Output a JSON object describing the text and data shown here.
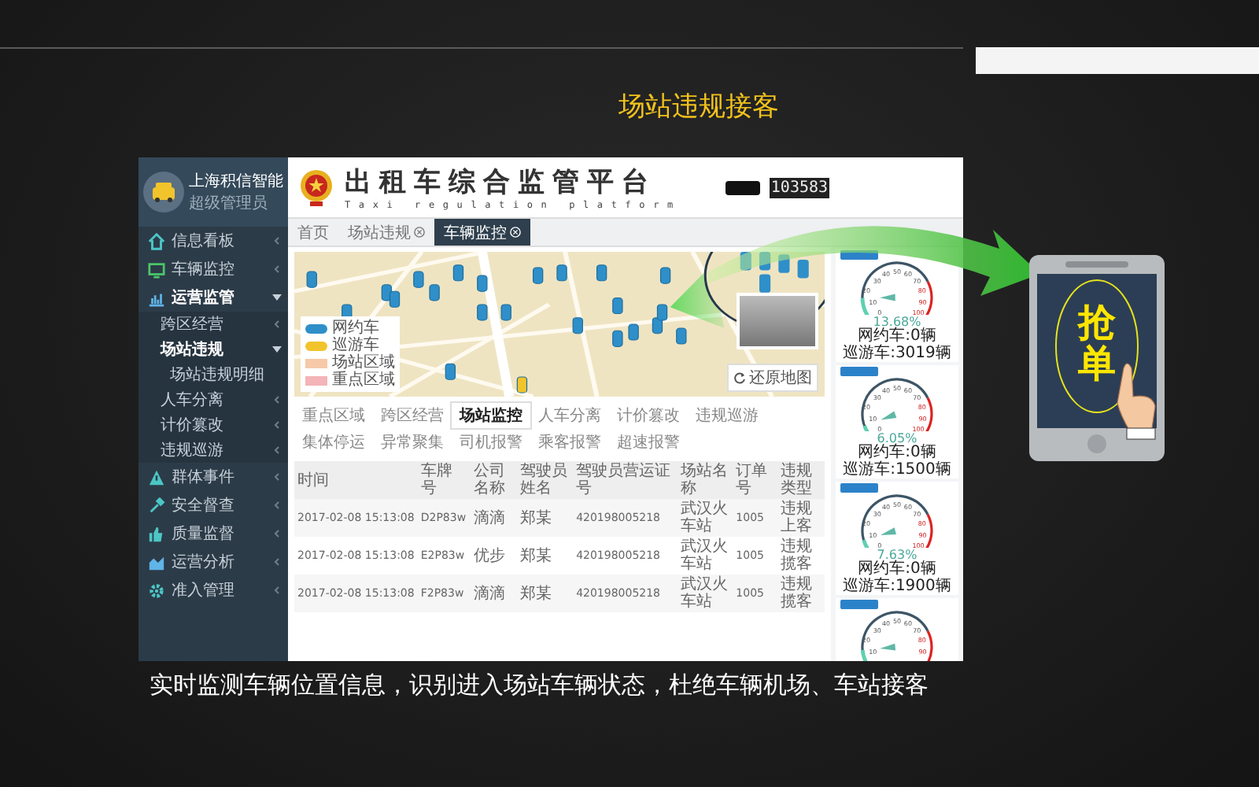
{
  "page": {
    "title": "场站违规接客",
    "caption": "实时监测车辆位置信息，识别进入场站车辆状态，杜绝车辆机场、车站接客"
  },
  "app": {
    "profile": {
      "name": "上海积信智能",
      "role": "超级管理员"
    },
    "sidebar": {
      "items": [
        {
          "label": "信息看板",
          "selected": false,
          "expanded": false
        },
        {
          "label": "车辆监控",
          "selected": false,
          "expanded": false
        },
        {
          "label": "运营监管",
          "selected": true,
          "expanded": true,
          "children": [
            {
              "label": "跨区经营",
              "selected": false,
              "expanded": false
            },
            {
              "label": "场站违规",
              "selected": true,
              "expanded": true,
              "children": [
                {
                  "label": "场站违规明细",
                  "selected": false,
                  "expanded": false
                }
              ]
            },
            {
              "label": "人车分离",
              "selected": false,
              "expanded": false
            },
            {
              "label": "计价篡改",
              "selected": false,
              "expanded": false
            },
            {
              "label": "违规巡游",
              "selected": false,
              "expanded": false
            }
          ]
        },
        {
          "label": "群体事件",
          "selected": false,
          "expanded": false
        },
        {
          "label": "安全督查",
          "selected": false,
          "expanded": false
        },
        {
          "label": "质量监督",
          "selected": false,
          "expanded": false
        },
        {
          "label": "运营分析",
          "selected": false,
          "expanded": false
        },
        {
          "label": "准入管理",
          "selected": false,
          "expanded": false
        }
      ]
    },
    "header": {
      "title": "出租车综合监管平台",
      "subtitle": "Taxi regulation platform",
      "counter": "103583"
    },
    "tabs": [
      {
        "label": "首页",
        "selected": false,
        "closable": false
      },
      {
        "label": "场站违规",
        "selected": false,
        "closable": true
      },
      {
        "label": "车辆监控",
        "selected": true,
        "closable": true
      }
    ],
    "map": {
      "legend": [
        {
          "label": "网约车",
          "kind": "car",
          "color": "#2f8fc9"
        },
        {
          "label": "巡游车",
          "kind": "car",
          "color": "#f2c42c"
        },
        {
          "label": "场站区域",
          "kind": "area",
          "color": "#f6c9a8"
        },
        {
          "label": "重点区域",
          "kind": "area",
          "color": "#f4b4b8"
        }
      ],
      "reset_button": "还原地图"
    },
    "monitor_tabs": [
      {
        "label": "重点区域",
        "selected": false
      },
      {
        "label": "跨区经营",
        "selected": false
      },
      {
        "label": "场站监控",
        "selected": true
      },
      {
        "label": "人车分离",
        "selected": false
      },
      {
        "label": "计价篡改",
        "selected": false
      },
      {
        "label": "违规巡游",
        "selected": false
      },
      {
        "label": "集体停运",
        "selected": false
      },
      {
        "label": "异常聚集",
        "selected": false
      },
      {
        "label": "司机报警",
        "selected": false
      },
      {
        "label": "乘客报警",
        "selected": false
      },
      {
        "label": "超速报警",
        "selected": false
      }
    ],
    "table": {
      "columns": [
        "时间",
        "车牌号",
        "公司名称",
        "驾驶员姓名",
        "驾驶员营运证号",
        "场站名称",
        "订单号",
        "违规类型"
      ],
      "rows": [
        [
          "2017-02-08 15:13:08",
          "D2P83w",
          "滴滴",
          "郑某",
          "420198005218",
          "武汉火车站",
          "1005",
          "违规上客"
        ],
        [
          "2017-02-08 15:13:08",
          "E2P83w",
          "优步",
          "郑某",
          "420198005218",
          "武汉火车站",
          "1005",
          "违规揽客"
        ],
        [
          "2017-02-08 15:13:08",
          "F2P83w",
          "滴滴",
          "郑某",
          "420198005218",
          "武汉火车站",
          "1005",
          "违规揽客"
        ]
      ]
    },
    "gauges": [
      {
        "level": 0.1368,
        "percent": "13.68%",
        "lines": [
          "网约车:0辆",
          "巡游车:3019辆"
        ],
        "scale": [
          "0",
          "10",
          "20",
          "30",
          "40",
          "50",
          "60",
          "70",
          "80",
          "90",
          "100"
        ]
      },
      {
        "level": 0.0605,
        "percent": "6.05%",
        "lines": [
          "网约车:0辆",
          "巡游车:1500辆"
        ],
        "scale": [
          "0",
          "10",
          "20",
          "30",
          "40",
          "50",
          "60",
          "70",
          "80",
          "90",
          "100"
        ]
      },
      {
        "level": 0.0763,
        "percent": "7.63%",
        "lines": [
          "网约车:0辆",
          "巡游车:1900辆"
        ],
        "scale": [
          "0",
          "10",
          "20",
          "30",
          "40",
          "50",
          "60",
          "70",
          "80",
          "90",
          "100"
        ]
      },
      {
        "level": 0.12,
        "scale": [
          "10",
          "20",
          "30",
          "40",
          "50",
          "60",
          "70",
          "80",
          "90"
        ]
      }
    ]
  },
  "phone": {
    "label": "抢单"
  }
}
